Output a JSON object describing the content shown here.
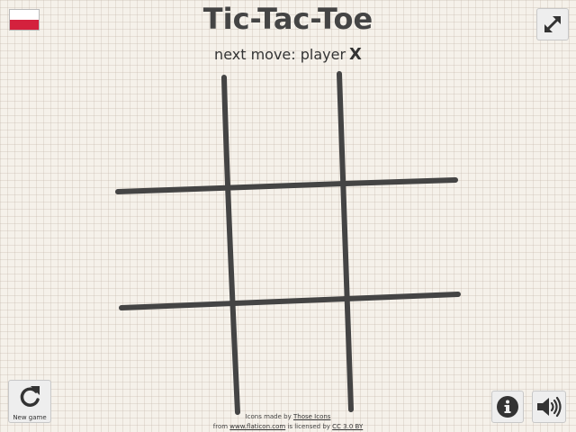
{
  "language": {
    "flag_name": "polish-flag",
    "colors": {
      "top": "#ffffff",
      "bottom": "#d4213d"
    }
  },
  "header": {
    "title": "Tic-Tac-Toe",
    "next_move_label": "next move: player",
    "next_player": "X"
  },
  "board": {
    "cells": [
      "",
      "",
      "",
      "",
      "",
      "",
      "",
      "",
      ""
    ],
    "line_color": "#444444"
  },
  "controls": {
    "fullscreen_icon": "expand-arrows-icon",
    "new_game_label": "New game",
    "new_game_icon": "restart-icon",
    "info_icon": "info-icon",
    "sound_icon": "speaker-icon"
  },
  "credits": {
    "line1_prefix": "Icons made by",
    "line1_author": "Those Icons",
    "line2_from": "from",
    "line2_site": "www.flaticon.com",
    "line2_mid": "is licensed by",
    "line2_license": "CC 3.0 BY"
  }
}
